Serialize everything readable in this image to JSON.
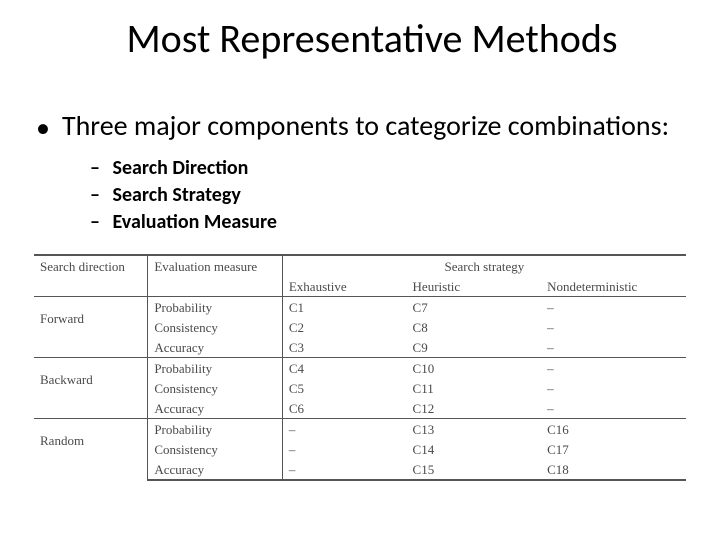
{
  "title": "Most Representative Methods",
  "bullet": {
    "text": "Three major components to categorize combinations:"
  },
  "subbullets": [
    "Search Direction",
    "Search Strategy",
    "Evaluation Measure"
  ],
  "table": {
    "headers": {
      "direction": "Search direction",
      "measure": "Evaluation measure",
      "strategy": "Search strategy",
      "ex": "Exhaustive",
      "he": "Heuristic",
      "nd": "Nondeterministic"
    },
    "groups": [
      {
        "direction": "Forward",
        "rows": [
          {
            "measure": "Probability",
            "ex": "C1",
            "he": "C7",
            "nd": "–"
          },
          {
            "measure": "Consistency",
            "ex": "C2",
            "he": "C8",
            "nd": "–"
          },
          {
            "measure": "Accuracy",
            "ex": "C3",
            "he": "C9",
            "nd": "–"
          }
        ]
      },
      {
        "direction": "Backward",
        "rows": [
          {
            "measure": "Probability",
            "ex": "C4",
            "he": "C10",
            "nd": "–"
          },
          {
            "measure": "Consistency",
            "ex": "C5",
            "he": "C11",
            "nd": "–"
          },
          {
            "measure": "Accuracy",
            "ex": "C6",
            "he": "C12",
            "nd": "–"
          }
        ]
      },
      {
        "direction": "Random",
        "rows": [
          {
            "measure": "Probability",
            "ex": "–",
            "he": "C13",
            "nd": "C16"
          },
          {
            "measure": "Consistency",
            "ex": "–",
            "he": "C14",
            "nd": "C17"
          },
          {
            "measure": "Accuracy",
            "ex": "–",
            "he": "C15",
            "nd": "C18"
          }
        ]
      }
    ]
  }
}
